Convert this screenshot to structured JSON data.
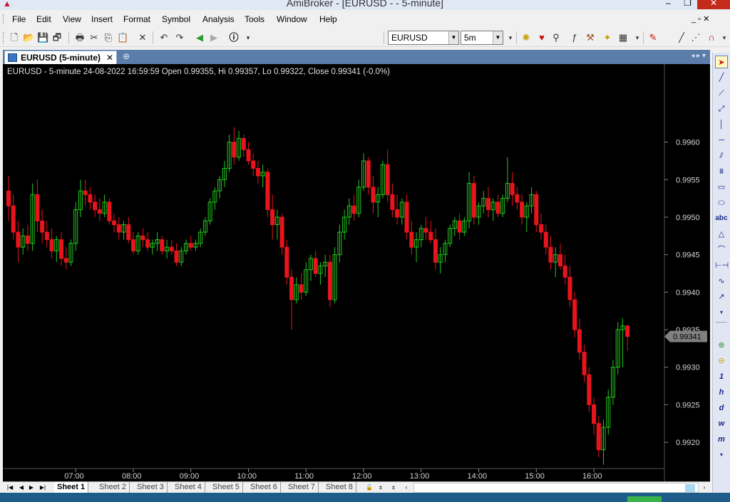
{
  "window": {
    "title": "AmiBroker - [EURUSD -  - 5-minute]",
    "controls": [
      "–",
      "❐",
      "✕"
    ]
  },
  "menu": {
    "items": [
      "File",
      "Edit",
      "View",
      "Insert",
      "Format",
      "Symbol",
      "Analysis",
      "Tools",
      "Window",
      "Help"
    ],
    "mdi_controls": "_ ▫ ✕"
  },
  "toolbar": {
    "symbol_value": "EURUSD",
    "interval_value": "5m"
  },
  "doc_tab": {
    "label": "EURUSD (5-minute)",
    "close": "✕"
  },
  "sheets": {
    "tabs": [
      "Sheet 1",
      "Sheet 2",
      "Sheet 3",
      "Sheet 4",
      "Sheet 5",
      "Sheet 6",
      "Sheet 7",
      "Sheet 8"
    ],
    "active": 0
  },
  "colors": {
    "background": "#000000",
    "bull": "#22c81e",
    "bear": "#e8141c",
    "text": "#d4d4d4",
    "price_tag": "#808080"
  },
  "chart_data": {
    "type": "candlestick",
    "title": "EURUSD - 5-minute 24-08-2022 16:59:59 Open 0.99355, Hi 0.99357, Lo 0.99322, Close 0.99341 (-0.0%)",
    "ylim": [
      0.99165,
      0.99685
    ],
    "yticks": [
      0.992,
      0.9925,
      0.993,
      0.9935,
      0.994,
      0.9945,
      0.995,
      0.9955,
      0.996
    ],
    "ytick_labels": [
      "0.9920",
      "0.9925",
      "0.9930",
      "0.9935",
      "0.9940",
      "0.9945",
      "0.9950",
      "0.9955",
      "0.9960"
    ],
    "xlabels": [
      "07:00",
      "08:00",
      "09:00",
      "10:00",
      "11:00",
      "12:00",
      "13:00",
      "14:00",
      "15:00",
      "16:00"
    ],
    "xlabel_bar_index": [
      14,
      26,
      38,
      50,
      62,
      74,
      86,
      98,
      110,
      122
    ],
    "last_price": "0.99341",
    "candles": [
      [
        0.99535,
        0.99555,
        0.99495,
        0.99515
      ],
      [
        0.99515,
        0.9953,
        0.9947,
        0.9948
      ],
      [
        0.9948,
        0.99495,
        0.9944,
        0.9946
      ],
      [
        0.9946,
        0.99485,
        0.9945,
        0.99475
      ],
      [
        0.99475,
        0.9949,
        0.99455,
        0.99465
      ],
      [
        0.99465,
        0.99545,
        0.99455,
        0.9953
      ],
      [
        0.9953,
        0.9955,
        0.9948,
        0.99495
      ],
      [
        0.99495,
        0.9951,
        0.99465,
        0.9948
      ],
      [
        0.9948,
        0.99495,
        0.9946,
        0.9947
      ],
      [
        0.9947,
        0.99485,
        0.99445,
        0.99455
      ],
      [
        0.99455,
        0.99475,
        0.9944,
        0.9947
      ],
      [
        0.9947,
        0.9948,
        0.99435,
        0.99445
      ],
      [
        0.99445,
        0.9946,
        0.9943,
        0.9944
      ],
      [
        0.9944,
        0.9947,
        0.99435,
        0.99465
      ],
      [
        0.99465,
        0.9952,
        0.99455,
        0.9951
      ],
      [
        0.9951,
        0.9955,
        0.995,
        0.99535
      ],
      [
        0.99535,
        0.9955,
        0.99515,
        0.9953
      ],
      [
        0.9953,
        0.9954,
        0.9951,
        0.9952
      ],
      [
        0.9952,
        0.9953,
        0.995,
        0.9951
      ],
      [
        0.9951,
        0.99525,
        0.99495,
        0.99505
      ],
      [
        0.99505,
        0.9953,
        0.995,
        0.9952
      ],
      [
        0.9952,
        0.99525,
        0.9949,
        0.99495
      ],
      [
        0.99495,
        0.99505,
        0.9948,
        0.9949
      ],
      [
        0.9949,
        0.995,
        0.9947,
        0.9948
      ],
      [
        0.9948,
        0.99495,
        0.9947,
        0.9949
      ],
      [
        0.9949,
        0.995,
        0.99465,
        0.9947
      ],
      [
        0.9947,
        0.9948,
        0.9945,
        0.99455
      ],
      [
        0.99455,
        0.9948,
        0.9945,
        0.99475
      ],
      [
        0.99475,
        0.99485,
        0.9946,
        0.9947
      ],
      [
        0.9947,
        0.9948,
        0.99455,
        0.9946
      ],
      [
        0.9946,
        0.9947,
        0.9945,
        0.99465
      ],
      [
        0.99465,
        0.9948,
        0.99455,
        0.9947
      ],
      [
        0.9947,
        0.99475,
        0.9945,
        0.99455
      ],
      [
        0.99455,
        0.9947,
        0.99445,
        0.9946
      ],
      [
        0.9946,
        0.9947,
        0.9945,
        0.99455
      ],
      [
        0.99455,
        0.99465,
        0.99435,
        0.9944
      ],
      [
        0.9944,
        0.9946,
        0.99435,
        0.99455
      ],
      [
        0.99455,
        0.9947,
        0.9945,
        0.99465
      ],
      [
        0.99465,
        0.99475,
        0.99455,
        0.9946
      ],
      [
        0.9946,
        0.9947,
        0.99455,
        0.99465
      ],
      [
        0.99465,
        0.99485,
        0.9946,
        0.9948
      ],
      [
        0.9948,
        0.995,
        0.99475,
        0.99495
      ],
      [
        0.99495,
        0.99525,
        0.9949,
        0.9952
      ],
      [
        0.9952,
        0.9954,
        0.9951,
        0.99535
      ],
      [
        0.99535,
        0.99555,
        0.99525,
        0.9955
      ],
      [
        0.9955,
        0.99575,
        0.9954,
        0.99565
      ],
      [
        0.99565,
        0.9961,
        0.9956,
        0.996
      ],
      [
        0.996,
        0.9962,
        0.9957,
        0.9958
      ],
      [
        0.9958,
        0.99615,
        0.99575,
        0.99605
      ],
      [
        0.99605,
        0.9961,
        0.9958,
        0.9959
      ],
      [
        0.9959,
        0.996,
        0.9957,
        0.99575
      ],
      [
        0.99575,
        0.99585,
        0.99555,
        0.99565
      ],
      [
        0.99565,
        0.99575,
        0.99545,
        0.99555
      ],
      [
        0.99555,
        0.9957,
        0.9954,
        0.9956
      ],
      [
        0.9956,
        0.99565,
        0.995,
        0.9951
      ],
      [
        0.9951,
        0.9953,
        0.9947,
        0.9949
      ],
      [
        0.9949,
        0.9951,
        0.9947,
        0.995
      ],
      [
        0.995,
        0.99505,
        0.9945,
        0.9946
      ],
      [
        0.9946,
        0.9947,
        0.9941,
        0.9942
      ],
      [
        0.9942,
        0.9943,
        0.9935,
        0.9939
      ],
      [
        0.9939,
        0.9942,
        0.99385,
        0.9941
      ],
      [
        0.9941,
        0.99425,
        0.9939,
        0.994
      ],
      [
        0.994,
        0.9944,
        0.99395,
        0.9943
      ],
      [
        0.9943,
        0.9945,
        0.99415,
        0.99445
      ],
      [
        0.99445,
        0.99455,
        0.9942,
        0.99425
      ],
      [
        0.99425,
        0.9944,
        0.9941,
        0.99435
      ],
      [
        0.99435,
        0.9945,
        0.9942,
        0.9944
      ],
      [
        0.9944,
        0.9945,
        0.9938,
        0.9939
      ],
      [
        0.9939,
        0.9946,
        0.99385,
        0.9945
      ],
      [
        0.9945,
        0.9949,
        0.9944,
        0.9948
      ],
      [
        0.9948,
        0.9951,
        0.9947,
        0.995
      ],
      [
        0.995,
        0.99525,
        0.9949,
        0.99515
      ],
      [
        0.99515,
        0.9953,
        0.99495,
        0.99505
      ],
      [
        0.99505,
        0.9955,
        0.995,
        0.9954
      ],
      [
        0.9954,
        0.99585,
        0.99535,
        0.99575
      ],
      [
        0.99575,
        0.9958,
        0.9953,
        0.9954
      ],
      [
        0.9954,
        0.99555,
        0.99505,
        0.9952
      ],
      [
        0.9952,
        0.9954,
        0.995,
        0.9953
      ],
      [
        0.9953,
        0.99575,
        0.99525,
        0.9957
      ],
      [
        0.9957,
        0.9959,
        0.9952,
        0.9953
      ],
      [
        0.9953,
        0.99545,
        0.995,
        0.9951
      ],
      [
        0.9951,
        0.9953,
        0.9949,
        0.995
      ],
      [
        0.995,
        0.99525,
        0.9949,
        0.9952
      ],
      [
        0.9952,
        0.9953,
        0.9947,
        0.9948
      ],
      [
        0.9948,
        0.99495,
        0.9945,
        0.9946
      ],
      [
        0.9946,
        0.9948,
        0.9944,
        0.9947
      ],
      [
        0.9947,
        0.9949,
        0.9946,
        0.99485
      ],
      [
        0.99485,
        0.995,
        0.9947,
        0.9948
      ],
      [
        0.9948,
        0.99495,
        0.99465,
        0.9947
      ],
      [
        0.9947,
        0.99485,
        0.9943,
        0.9944
      ],
      [
        0.9944,
        0.9946,
        0.99425,
        0.9945
      ],
      [
        0.9945,
        0.9947,
        0.9944,
        0.99465
      ],
      [
        0.99465,
        0.9949,
        0.9946,
        0.99485
      ],
      [
        0.99485,
        0.995,
        0.99475,
        0.99495
      ],
      [
        0.99495,
        0.99505,
        0.9947,
        0.9948
      ],
      [
        0.9948,
        0.995,
        0.99475,
        0.99495
      ],
      [
        0.99495,
        0.9956,
        0.99485,
        0.99545
      ],
      [
        0.99545,
        0.99555,
        0.9949,
        0.995
      ],
      [
        0.995,
        0.9952,
        0.9949,
        0.99515
      ],
      [
        0.99515,
        0.99535,
        0.99505,
        0.99525
      ],
      [
        0.99525,
        0.9954,
        0.995,
        0.9951
      ],
      [
        0.9951,
        0.99525,
        0.99495,
        0.9952
      ],
      [
        0.9952,
        0.9953,
        0.995,
        0.99505
      ],
      [
        0.99505,
        0.9953,
        0.995,
        0.99525
      ],
      [
        0.99525,
        0.9958,
        0.9952,
        0.99545
      ],
      [
        0.99545,
        0.9956,
        0.99515,
        0.9953
      ],
      [
        0.9953,
        0.9954,
        0.9951,
        0.9952
      ],
      [
        0.9952,
        0.9953,
        0.9949,
        0.995
      ],
      [
        0.995,
        0.9952,
        0.9948,
        0.99515
      ],
      [
        0.99515,
        0.9954,
        0.99505,
        0.9953
      ],
      [
        0.9953,
        0.99535,
        0.9948,
        0.9949
      ],
      [
        0.9949,
        0.99505,
        0.9947,
        0.9948
      ],
      [
        0.9948,
        0.9949,
        0.9945,
        0.9946
      ],
      [
        0.9946,
        0.99475,
        0.9943,
        0.9944
      ],
      [
        0.9944,
        0.9946,
        0.9942,
        0.9945
      ],
      [
        0.9945,
        0.99465,
        0.9943,
        0.99435
      ],
      [
        0.99435,
        0.9945,
        0.9941,
        0.9942
      ],
      [
        0.9942,
        0.99435,
        0.9938,
        0.9939
      ],
      [
        0.9939,
        0.994,
        0.9934,
        0.9935
      ],
      [
        0.9935,
        0.99365,
        0.9931,
        0.9932
      ],
      [
        0.9932,
        0.9933,
        0.9928,
        0.9929
      ],
      [
        0.9929,
        0.993,
        0.9924,
        0.9925
      ],
      [
        0.9925,
        0.9926,
        0.9921,
        0.99225
      ],
      [
        0.99225,
        0.99235,
        0.9918,
        0.9919
      ],
      [
        0.9919,
        0.9923,
        0.9917,
        0.9922
      ],
      [
        0.9922,
        0.9927,
        0.9921,
        0.9926
      ],
      [
        0.9926,
        0.9931,
        0.9925,
        0.993
      ],
      [
        0.993,
        0.9936,
        0.9929,
        0.9935
      ],
      [
        0.9935,
        0.99365,
        0.993,
        0.99355
      ],
      [
        0.99355,
        0.99357,
        0.99322,
        0.99341
      ]
    ]
  },
  "sidebar_tools": [
    "select-arrow",
    "line",
    "ray",
    "extended-line",
    "vertical-line",
    "horizontal-line",
    "parallel-lines",
    "fibonacci",
    "rectangle",
    "ellipse",
    "text",
    "triangle",
    "arc",
    "cycles",
    "freehand",
    "arrow",
    "zoom-in",
    "zoom-out",
    "interval-1",
    "interval-h",
    "interval-d",
    "interval-w",
    "interval-m"
  ],
  "sidebar_labels": {
    "text_tool": "abc",
    "interval_1": "1",
    "interval_h": "h",
    "interval_d": "d",
    "interval_w": "w",
    "interval_m": "m"
  }
}
